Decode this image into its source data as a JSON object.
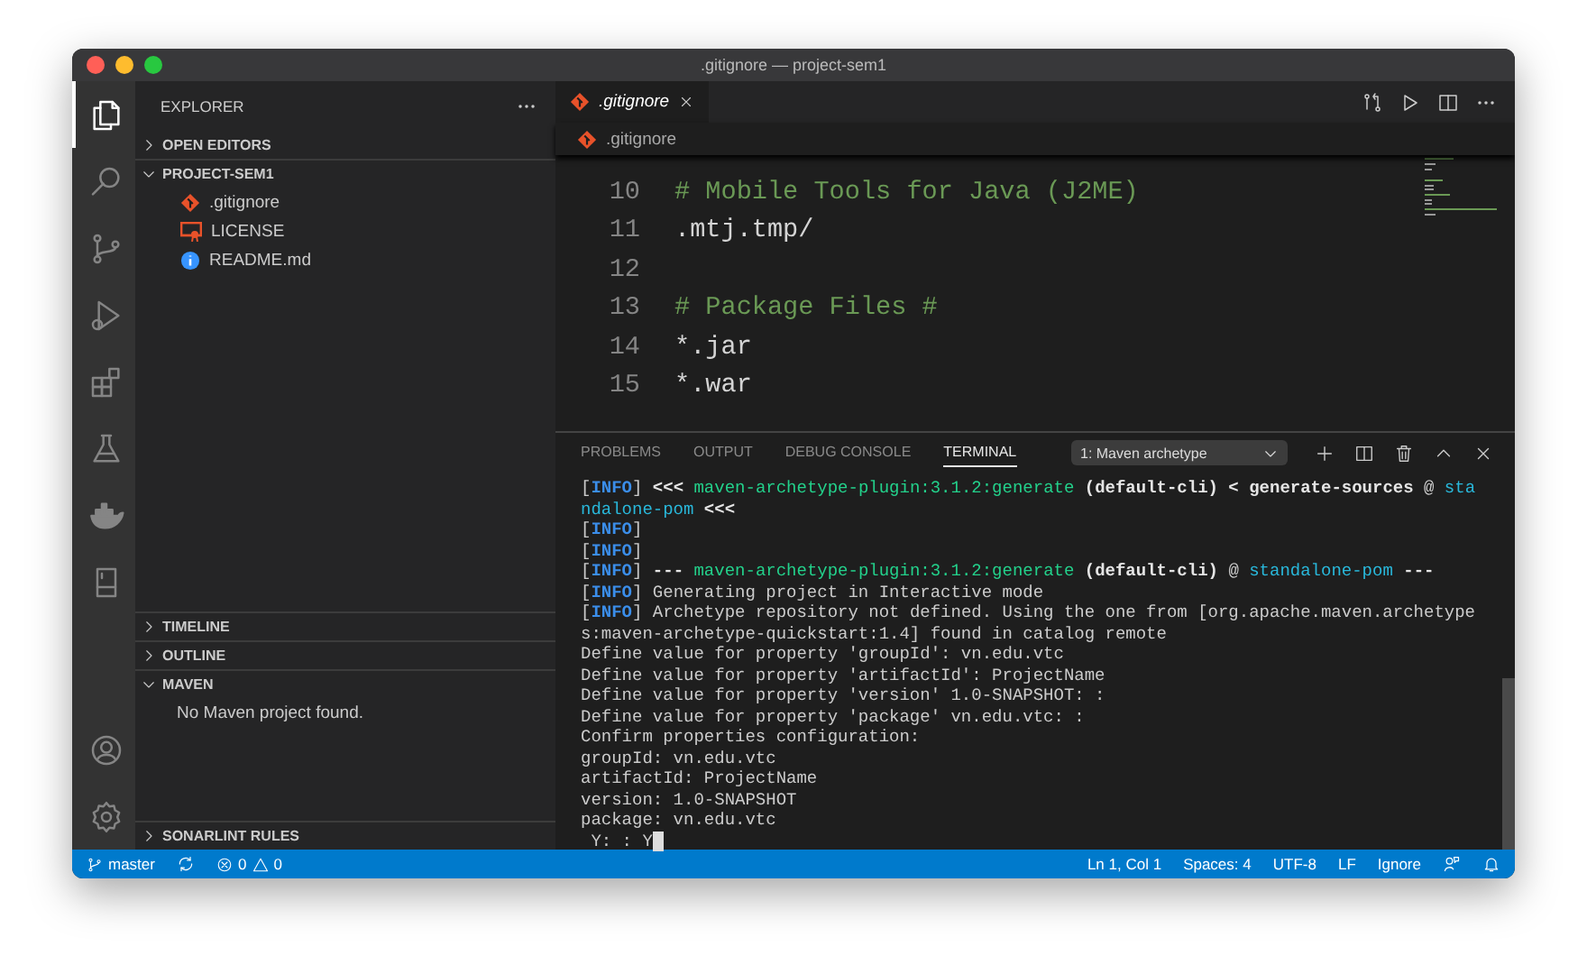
{
  "window": {
    "title": ".gitignore — project-sem1"
  },
  "activity_bar": {
    "top": [
      {
        "kind": "files",
        "selected": true
      },
      {
        "kind": "search",
        "selected": false
      },
      {
        "kind": "scm",
        "selected": false
      },
      {
        "kind": "run",
        "selected": false
      },
      {
        "kind": "extensions",
        "selected": false
      },
      {
        "kind": "flask",
        "selected": false
      },
      {
        "kind": "docker",
        "selected": false
      },
      {
        "kind": "book",
        "selected": false
      }
    ],
    "bottom": [
      {
        "kind": "account",
        "selected": false
      },
      {
        "kind": "settings",
        "selected": false
      }
    ]
  },
  "sidebar": {
    "title": "EXPLORER",
    "sections": [
      {
        "label": "OPEN EDITORS",
        "expanded": false
      },
      {
        "label": "PROJECT-SEM1",
        "expanded": true,
        "files": [
          {
            "name": ".gitignore",
            "kind": "git"
          },
          {
            "name": "LICENSE",
            "kind": "license"
          },
          {
            "name": "README.md",
            "kind": "info"
          }
        ]
      },
      {
        "label": "TIMELINE",
        "expanded": false
      },
      {
        "label": "OUTLINE",
        "expanded": false
      },
      {
        "label": "MAVEN",
        "expanded": true,
        "message": "No Maven project found."
      },
      {
        "label": "SONARLINT RULES",
        "expanded": false
      }
    ]
  },
  "editor": {
    "tabs": [
      {
        "label": ".gitignore",
        "kind": "git",
        "selected": true
      }
    ],
    "breadcrumb": [
      {
        "label": ".gitignore",
        "kind": "git"
      }
    ],
    "lines": [
      {
        "number": "10",
        "text": "# Mobile Tools for Java (J2ME)",
        "kind": "comment"
      },
      {
        "number": "11",
        "text": ".mtj.tmp/",
        "kind": "plain"
      },
      {
        "number": "12"
      },
      {
        "number": "13",
        "text": "# Package Files #",
        "kind": "comment"
      },
      {
        "number": "14",
        "text": "*.jar",
        "kind": "plain"
      },
      {
        "number": "15",
        "text": "*.war",
        "kind": "plain"
      }
    ]
  },
  "panel": {
    "tabs": [
      {
        "label": "PROBLEMS",
        "selected": false
      },
      {
        "label": "OUTPUT",
        "selected": false
      },
      {
        "label": "DEBUG CONSOLE",
        "selected": false
      },
      {
        "label": "TERMINAL",
        "selected": true
      }
    ],
    "terminal_select": "1: Maven archetype",
    "terminal": [
      [
        {
          "text": "[",
          "kind": "plain"
        },
        {
          "text": "INFO",
          "kind": "info"
        },
        {
          "text": "] ",
          "kind": "plain"
        },
        {
          "text": "<<< ",
          "kind": "bold"
        },
        {
          "text": "maven-archetype-plugin:3.1.2:generate",
          "kind": "plugin"
        },
        {
          "text": " (default-cli) < generate-sources ",
          "kind": "bold"
        },
        {
          "text": "@ ",
          "kind": "plain"
        },
        {
          "text": "sta",
          "kind": "link"
        }
      ],
      [
        {
          "text": "ndalone-pom",
          "kind": "link"
        },
        {
          "text": " <<<",
          "kind": "bold"
        }
      ],
      [
        {
          "text": "[",
          "kind": "plain"
        },
        {
          "text": "INFO",
          "kind": "info"
        },
        {
          "text": "]",
          "kind": "plain"
        }
      ],
      [
        {
          "text": "[",
          "kind": "plain"
        },
        {
          "text": "INFO",
          "kind": "info"
        },
        {
          "text": "]",
          "kind": "plain"
        }
      ],
      [
        {
          "text": "[",
          "kind": "plain"
        },
        {
          "text": "INFO",
          "kind": "info"
        },
        {
          "text": "] ",
          "kind": "plain"
        },
        {
          "text": "--- ",
          "kind": "bold"
        },
        {
          "text": "maven-archetype-plugin:3.1.2:generate",
          "kind": "plugin"
        },
        {
          "text": " (default-cli) ",
          "kind": "bold"
        },
        {
          "text": "@ ",
          "kind": "plain"
        },
        {
          "text": "standalone-pom",
          "kind": "link"
        },
        {
          "text": " ---",
          "kind": "bold"
        }
      ],
      [
        {
          "text": "[",
          "kind": "plain"
        },
        {
          "text": "INFO",
          "kind": "info"
        },
        {
          "text": "] Generating project in Interactive mode",
          "kind": "plain"
        }
      ],
      [
        {
          "text": "[",
          "kind": "plain"
        },
        {
          "text": "INFO",
          "kind": "info"
        },
        {
          "text": "] Archetype repository not defined. Using the one from [org.apache.maven.archetype",
          "kind": "plain"
        }
      ],
      [
        {
          "text": "s:maven-archetype-quickstart:1.4] found in catalog remote",
          "kind": "plain"
        }
      ],
      [
        {
          "text": "Define value for property 'groupId': vn.edu.vtc",
          "kind": "plain"
        }
      ],
      [
        {
          "text": "Define value for property 'artifactId': ProjectName",
          "kind": "plain"
        }
      ],
      [
        {
          "text": "Define value for property 'version' 1.0-SNAPSHOT: :",
          "kind": "plain"
        }
      ],
      [
        {
          "text": "Define value for property 'package' vn.edu.vtc: :",
          "kind": "plain"
        }
      ],
      [
        {
          "text": "Confirm properties configuration:",
          "kind": "plain"
        }
      ],
      [
        {
          "text": "groupId: vn.edu.vtc",
          "kind": "plain"
        }
      ],
      [
        {
          "text": "artifactId: ProjectName",
          "kind": "plain"
        }
      ],
      [
        {
          "text": "version: 1.0-SNAPSHOT",
          "kind": "plain"
        }
      ],
      [
        {
          "text": "package: vn.edu.vtc",
          "kind": "plain"
        }
      ],
      [
        {
          "text": " Y: : Y",
          "kind": "plain"
        }
      ]
    ],
    "cursor": true
  },
  "status_bar": {
    "left": [
      {
        "kind": "branch",
        "text": "master"
      },
      {
        "kind": "sync"
      },
      {
        "kind": "problems",
        "errors": "0",
        "warnings": "0"
      }
    ],
    "right": [
      {
        "kind": "text",
        "text": "Ln 1, Col 1"
      },
      {
        "kind": "text",
        "text": "Spaces: 4"
      },
      {
        "kind": "text",
        "text": "UTF-8"
      },
      {
        "kind": "text",
        "text": "LF"
      },
      {
        "kind": "text",
        "text": "Ignore"
      },
      {
        "kind": "feedback"
      },
      {
        "kind": "bell"
      }
    ]
  }
}
